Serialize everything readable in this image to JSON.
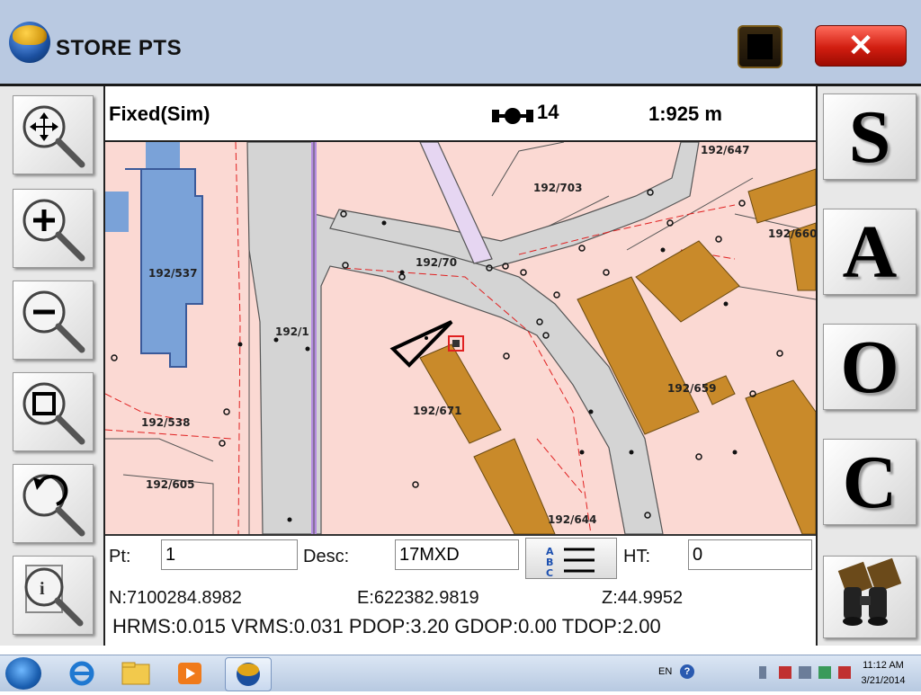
{
  "app": {
    "title": "STORE PTS",
    "close_label": "✕"
  },
  "status": {
    "fix": "Fixed(Sim)",
    "satellites": "14",
    "scale": "1:925 m"
  },
  "toolbar_left": [
    "pan-zoom",
    "zoom-in",
    "zoom-out",
    "zoom-extents",
    "zoom-previous",
    "zoom-info"
  ],
  "toolbar_right": {
    "letters": [
      "S",
      "A",
      "O",
      "C"
    ],
    "last": "binoculars"
  },
  "map": {
    "parcel_labels": [
      "192/647",
      "192/703",
      "192/660",
      "192/537",
      "192/70",
      "192/1",
      "192/659",
      "192/671",
      "192/538",
      "192/605",
      "192/644"
    ]
  },
  "form": {
    "pt_label": "Pt:",
    "pt_value": "1",
    "desc_label": "Desc:",
    "desc_value": "17MXD",
    "ht_label": "HT:",
    "ht_value": "0",
    "north": "N:7100284.8982",
    "east": "E:622382.9819",
    "z": "Z:44.9952",
    "quality": "HRMS:0.015 VRMS:0.031 PDOP:3.20 GDOP:0.00 TDOP:2.00"
  },
  "taskbar": {
    "lang": "EN",
    "time": "11:12 AM",
    "date": "3/21/2014"
  },
  "colors": {
    "parcel": "#fbd9d3",
    "road": "#d4d4d4",
    "building": "#c98a2a",
    "building_blue": "#7aa2d8",
    "boundary": "#e02020"
  }
}
